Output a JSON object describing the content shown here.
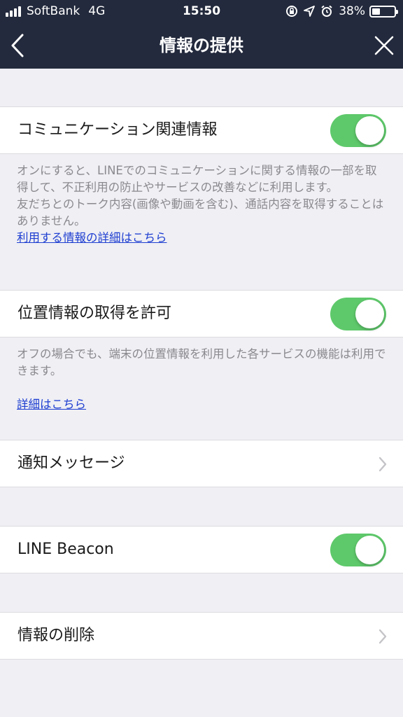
{
  "status_bar": {
    "carrier": "SoftBank",
    "network": "4G",
    "time": "15:50",
    "battery_percent": "38%",
    "battery_level": 0.38
  },
  "nav": {
    "title": "情報の提供",
    "back_icon": "chevron-left-icon",
    "close_icon": "close-icon"
  },
  "colors": {
    "header_bg": "#232a3d",
    "toggle_on": "#5ec96b",
    "link": "#1f3fd1",
    "page_bg": "#efeff4"
  },
  "sections": {
    "communication": {
      "label": "コミュニケーション関連情報",
      "toggle_on": true,
      "description_1": "オンにすると、LINEでのコミュニケーションに関する情報の一部を取得して、不正利用の防止やサービスの改善などに利用します。",
      "description_2": "友だちとのトーク内容(画像や動画を含む)、通話内容を取得することはありません。",
      "link": "利用する情報の詳細はこちら"
    },
    "location": {
      "label": "位置情報の取得を許可",
      "toggle_on": true,
      "description": "オフの場合でも、端末の位置情報を利用した各サービスの機能は利用できます。",
      "link": "詳細はこちら"
    },
    "notification": {
      "label": "通知メッセージ"
    },
    "beacon": {
      "label": "LINE Beacon",
      "toggle_on": true
    },
    "delete": {
      "label": "情報の削除"
    }
  }
}
